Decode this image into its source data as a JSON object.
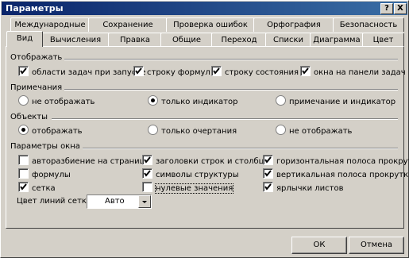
{
  "window": {
    "title": "Параметры",
    "help_label": "?",
    "close_label": "X"
  },
  "tabs": {
    "back_row": [
      "Международные",
      "Сохранение",
      "Проверка ошибок",
      "Орфография",
      "Безопасность"
    ],
    "front_row": [
      "Вид",
      "Вычисления",
      "Правка",
      "Общие",
      "Переход",
      "Списки",
      "Диаграмма",
      "Цвет"
    ],
    "active": "Вид"
  },
  "section_display": {
    "title": "Отображать",
    "options": [
      {
        "label": "области задач при запуске",
        "checked": true
      },
      {
        "label": "строку формул",
        "checked": true
      },
      {
        "label": "строку состояния",
        "checked": true
      },
      {
        "label": "окна на панели задач",
        "checked": true
      }
    ]
  },
  "section_notes": {
    "title": "Примечания",
    "options": [
      {
        "label": "не отображать",
        "selected": false
      },
      {
        "label": "только индикатор",
        "selected": true
      },
      {
        "label": "примечание и индикатор",
        "selected": false
      }
    ]
  },
  "section_objects": {
    "title": "Объекты",
    "options": [
      {
        "label": "отображать",
        "selected": true
      },
      {
        "label": "только очертания",
        "selected": false
      },
      {
        "label": "не отображать",
        "selected": false
      }
    ]
  },
  "section_window": {
    "title": "Параметры окна",
    "options": [
      {
        "label": "авторазбиение на страницы",
        "checked": false
      },
      {
        "label": "заголовки строк и столбцов",
        "checked": true
      },
      {
        "label": "горизонтальная полоса прокрутки",
        "checked": true
      },
      {
        "label": "формулы",
        "checked": false
      },
      {
        "label": "символы структуры",
        "checked": true
      },
      {
        "label": "вертикальная полоса прокрутки",
        "checked": true
      },
      {
        "label": "сетка",
        "checked": true
      },
      {
        "label": "нулевые значения",
        "checked": false
      },
      {
        "label": "ярлычки листов",
        "checked": true
      }
    ],
    "gridline_color_label": "Цвет линий сетки:",
    "gridline_color_value": "Авто"
  },
  "buttons": {
    "ok": "ОК",
    "cancel": "Отмена"
  }
}
